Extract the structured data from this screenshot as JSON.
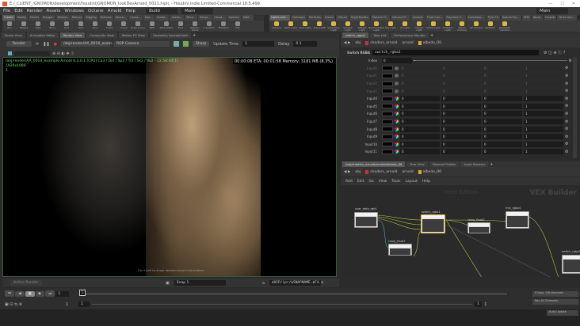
{
  "window": {
    "title": "E:/_CLIENT_/GNOMON/development/houdini/GNOMON_lookDevArnold_0021.hiplc - Houdini Indie Limited-Commercial 18.5.499",
    "controls": [
      "—",
      "☐",
      "✕"
    ]
  },
  "menu": {
    "items": [
      "File",
      "Edit",
      "Render",
      "Assets",
      "Windows",
      "Octane",
      "Arnold",
      "Help"
    ],
    "desktop": "Build",
    "desktop_right": "Main"
  },
  "shelf_tabs_left": [
    "Create",
    "Modify",
    "Model",
    "Polygon",
    "Deform",
    "Texture",
    "Rigging",
    "Muscles",
    "Chara...",
    "Const...",
    "Hair...",
    "Guide...",
    "Guide...",
    "Terra...",
    "Simpl...",
    "Cloud...",
    "Volume",
    "Sdef..."
  ],
  "shelf_tabs_right": [
    "Lights and...",
    "Collisions",
    "Particles",
    "Grains",
    "Vellum",
    "Rigid Bodies",
    "Particle Fl...",
    "Viscous Fl...",
    "Oceans",
    "Fluid Con...",
    "Populate C...",
    "Container...",
    "Pyro FX",
    "Sparse Pyr...",
    "FEM",
    "Wires",
    "Crowds",
    "Drive Sim..."
  ],
  "tools_left": [
    "Box",
    "Sphere",
    "Tube",
    "Torus",
    "Grid",
    "Null",
    "Line",
    "Circle",
    "Curve",
    "Draw Curve",
    "Path",
    "Spray Paint",
    "Font",
    "Platonic Solids",
    "L-System",
    "Metaball",
    "File"
  ],
  "tools_right": [
    "Camera",
    "Point Light",
    "Spot Light",
    "Area Light",
    "Geometry Light",
    "Volume Light",
    "Distant Light",
    "Environment Light",
    "Sky Light",
    "GI Light",
    "Caustic Light",
    "Portal Light",
    "Ambient Light",
    "Stereo Camera",
    "VR Camera",
    "Switcher",
    "Gamepad Camera"
  ],
  "left_pane_tabs": [
    "Scene View",
    "Animation Editor",
    "Render View",
    "Composite View",
    "Motion FX View",
    "Geometry Spreadsheet"
  ],
  "render_toolbar": {
    "render": "Render",
    "rop": "/obj/render/AA_0010_exam...",
    "camera": "ROP Camera",
    "mode": "Sharp",
    "update_label": "Update Time",
    "update_value": "1",
    "delay_label": "Delay",
    "delay_value": "0.1"
  },
  "render_view": {
    "status": "/obj/render/AA_0010_example  Arnold 6.2.0.1 [CPU] Ca3 / Di4 / Sp2 / Tr2 / Ss2 / Vo2 - 22:58:40[1]",
    "progress": "00:00:08  ETA: 00:01:58  Memory: 3181 MB  (8.3%)",
    "resolution": "1920x1080",
    "frame": "1",
    "hint": "Ctrl+Left to show detailed pixel information."
  },
  "render_bottom": {
    "active": "Active Render",
    "snap": "Snap 1",
    "path": "$HIP/ipr/$SNAPNAME.$F4.$"
  },
  "timeline": {
    "frame": "1",
    "start": "1",
    "end": "1",
    "marker": "1",
    "end_frame": "1",
    "end2": "1"
  },
  "param_tabs": [
    "switch_rgba1",
    "Take List",
    "Performance Monitor"
  ],
  "path": [
    "obj",
    "shaders_arnold",
    "arnold",
    "albedo_06"
  ],
  "params": {
    "type": "Switch RGBA",
    "name": "switch_rgba1",
    "index_label": "Index",
    "index": "0",
    "rows": [
      {
        "label": "Input0",
        "v": [
          "0",
          "0",
          "0",
          "1"
        ],
        "enabled": false
      },
      {
        "label": "Input1",
        "v": [
          "0",
          "0",
          "0",
          "1"
        ],
        "enabled": false
      },
      {
        "label": "Input2",
        "v": [
          "0",
          "0",
          "0",
          "1"
        ],
        "enabled": false
      },
      {
        "label": "Input3",
        "v": [
          "0",
          "0",
          "0",
          "1"
        ],
        "enabled": false
      },
      {
        "label": "Input4",
        "v": [
          "0",
          "0",
          "0",
          "1"
        ],
        "enabled": true
      },
      {
        "label": "Input5",
        "v": [
          "0",
          "0",
          "0",
          "1"
        ],
        "enabled": true
      },
      {
        "label": "Input6",
        "v": [
          "0",
          "0",
          "0",
          "1"
        ],
        "enabled": true
      },
      {
        "label": "Input7",
        "v": [
          "0",
          "0",
          "0",
          "1"
        ],
        "enabled": true
      },
      {
        "label": "Input8",
        "v": [
          "0",
          "0",
          "0",
          "1"
        ],
        "enabled": true
      },
      {
        "label": "Input9",
        "v": [
          "0",
          "0",
          "0",
          "1"
        ],
        "enabled": true
      },
      {
        "label": "Input10",
        "v": [
          "0",
          "0",
          "0",
          "1"
        ],
        "enabled": true
      },
      {
        "label": "Input11",
        "v": [
          "0",
          "0",
          "0",
          "1"
        ],
        "enabled": true
      }
    ]
  },
  "net_tabs": [
    "/obj/shaders_arnold/arnold/albedo_06",
    "Tree View",
    "Material Palette",
    "Asset Browser"
  ],
  "net_menu": [
    "Add",
    "Edit",
    "Go",
    "View",
    "Tools",
    "Layout",
    "Help"
  ],
  "network": {
    "watermark": "Indie Edition",
    "context": "VEX Builder",
    "nodes": [
      "user_data_rgb1",
      "switch_rgba1",
      "ramp_float2",
      "mix_rgba4",
      "ramp_float1",
      "switch_rgba2"
    ]
  },
  "keys": {
    "channels": "0 keys, 0/0 channels",
    "key_all": "Key All Channels",
    "auto": "Auto Update"
  },
  "colors": {
    "selected_node": "#e0c040",
    "wire": "#b8c040",
    "status_green": "#6fe06f"
  }
}
